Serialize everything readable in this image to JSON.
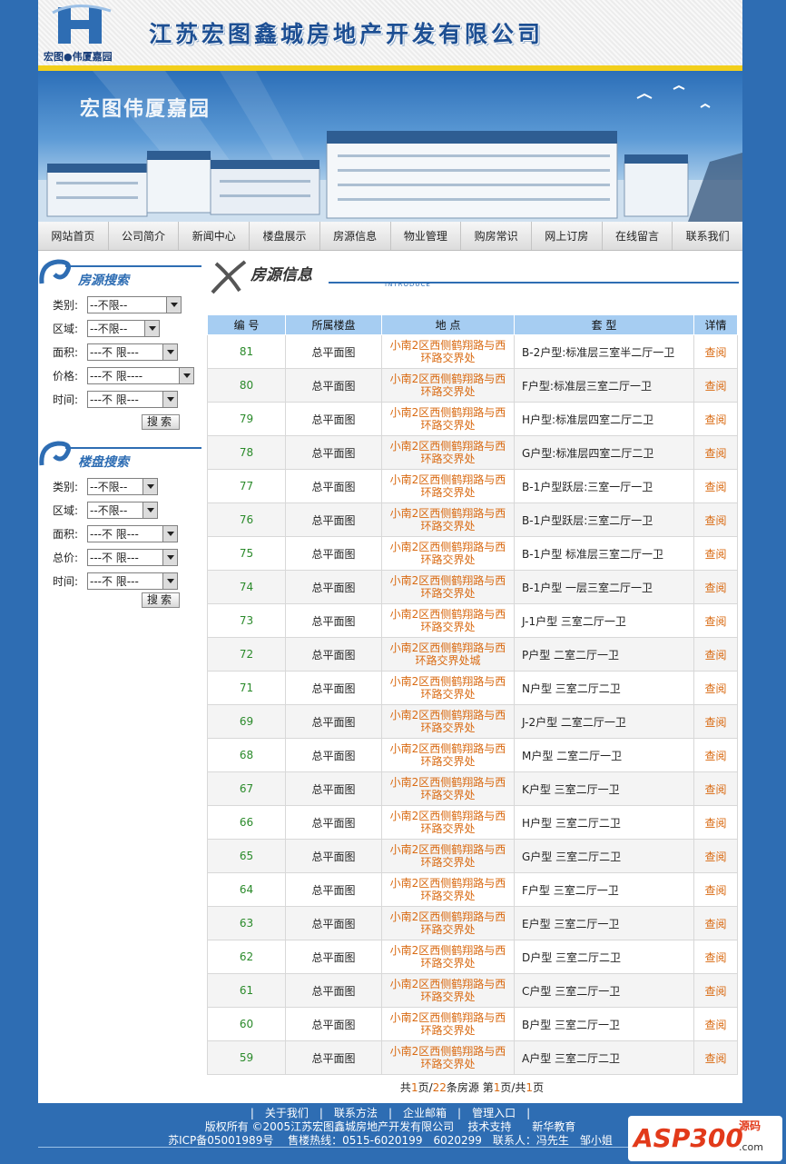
{
  "header": {
    "logo_caption": "宏图●伟厦嘉园",
    "company_name": "江苏宏图鑫城房地产开发有限公司"
  },
  "banner": {
    "title": "宏图伟厦嘉园"
  },
  "nav": [
    "网站首页",
    "公司简介",
    "新闻中心",
    "楼盘展示",
    "房源信息",
    "物业管理",
    "购房常识",
    "网上订房",
    "在线留言",
    "联系我们"
  ],
  "sidebar": {
    "house_search": {
      "title": "房源搜索",
      "fields": [
        {
          "label": "类别:",
          "value": "--不限--"
        },
        {
          "label": "区域:",
          "value": "--不限--"
        },
        {
          "label": "面积:",
          "value": "---不 限---"
        },
        {
          "label": "价格:",
          "value": "---不 限----"
        },
        {
          "label": "时间:",
          "value": "---不 限---"
        }
      ],
      "button": "搜索"
    },
    "estate_search": {
      "title": "楼盘搜索",
      "fields": [
        {
          "label": "类别:",
          "value": "--不限--"
        },
        {
          "label": "区域:",
          "value": "--不限--"
        },
        {
          "label": "面积:",
          "value": "---不 限---"
        },
        {
          "label": "总价:",
          "value": "---不 限---"
        },
        {
          "label": "时间:",
          "value": "---不 限---"
        }
      ],
      "button": "搜索"
    }
  },
  "content": {
    "title": "房源信息",
    "subtitle": "INTRODUCE",
    "columns": [
      "编 号",
      "所属楼盘",
      "地  点",
      "套  型",
      "详情"
    ],
    "rows": [
      {
        "id": "81",
        "estate": "总平面图",
        "location": "小南2区西侧鹤翔路与西环路交界处",
        "type": "B-2户型:标准层三室半二厅一卫",
        "detail": "查阅"
      },
      {
        "id": "80",
        "estate": "总平面图",
        "location": "小南2区西侧鹤翔路与西环路交界处",
        "type": "F户型:标准层三室二厅一卫",
        "detail": "查阅"
      },
      {
        "id": "79",
        "estate": "总平面图",
        "location": "小南2区西侧鹤翔路与西环路交界处",
        "type": "H户型:标准层四室二厅二卫",
        "detail": "查阅"
      },
      {
        "id": "78",
        "estate": "总平面图",
        "location": "小南2区西侧鹤翔路与西环路交界处",
        "type": "G户型:标准层四室二厅二卫",
        "detail": "查阅"
      },
      {
        "id": "77",
        "estate": "总平面图",
        "location": "小南2区西侧鹤翔路与西环路交界处",
        "type": "B-1户型跃层:三室一厅一卫",
        "detail": "查阅"
      },
      {
        "id": "76",
        "estate": "总平面图",
        "location": "小南2区西侧鹤翔路与西环路交界处",
        "type": "B-1户型跃层:三室二厅一卫",
        "detail": "查阅"
      },
      {
        "id": "75",
        "estate": "总平面图",
        "location": "小南2区西侧鹤翔路与西环路交界处",
        "type": "B-1户型 标准层三室二厅一卫",
        "detail": "查阅"
      },
      {
        "id": "74",
        "estate": "总平面图",
        "location": "小南2区西侧鹤翔路与西环路交界处",
        "type": "B-1户型 一层三室二厅一卫",
        "detail": "查阅"
      },
      {
        "id": "73",
        "estate": "总平面图",
        "location": "小南2区西侧鹤翔路与西环路交界处",
        "type": "J-1户型 三室二厅一卫",
        "detail": "查阅"
      },
      {
        "id": "72",
        "estate": "总平面图",
        "location": "小南2区西侧鹤翔路与西环路交界处城",
        "type": "P户型 二室二厅一卫",
        "detail": "查阅"
      },
      {
        "id": "71",
        "estate": "总平面图",
        "location": "小南2区西侧鹤翔路与西环路交界处",
        "type": "N户型 三室二厅二卫",
        "detail": "查阅"
      },
      {
        "id": "69",
        "estate": "总平面图",
        "location": "小南2区西侧鹤翔路与西环路交界处",
        "type": "J-2户型 二室二厅一卫",
        "detail": "查阅"
      },
      {
        "id": "68",
        "estate": "总平面图",
        "location": "小南2区西侧鹤翔路与西环路交界处",
        "type": "M户型 二室二厅一卫",
        "detail": "查阅"
      },
      {
        "id": "67",
        "estate": "总平面图",
        "location": "小南2区西侧鹤翔路与西环路交界处",
        "type": "K户型 三室二厅一卫",
        "detail": "查阅"
      },
      {
        "id": "66",
        "estate": "总平面图",
        "location": "小南2区西侧鹤翔路与西环路交界处",
        "type": "H户型 三室二厅二卫",
        "detail": "查阅"
      },
      {
        "id": "65",
        "estate": "总平面图",
        "location": "小南2区西侧鹤翔路与西环路交界处",
        "type": "G户型 三室二厅二卫",
        "detail": "查阅"
      },
      {
        "id": "64",
        "estate": "总平面图",
        "location": "小南2区西侧鹤翔路与西环路交界处",
        "type": "F户型 三室二厅一卫",
        "detail": "查阅"
      },
      {
        "id": "63",
        "estate": "总平面图",
        "location": "小南2区西侧鹤翔路与西环路交界处",
        "type": "E户型 三室二厅一卫",
        "detail": "查阅"
      },
      {
        "id": "62",
        "estate": "总平面图",
        "location": "小南2区西侧鹤翔路与西环路交界处",
        "type": "D户型 三室二厅二卫",
        "detail": "查阅"
      },
      {
        "id": "61",
        "estate": "总平面图",
        "location": "小南2区西侧鹤翔路与西环路交界处",
        "type": "C户型 三室二厅一卫",
        "detail": "查阅"
      },
      {
        "id": "60",
        "estate": "总平面图",
        "location": "小南2区西侧鹤翔路与西环路交界处",
        "type": "B户型 三室二厅一卫",
        "detail": "查阅"
      },
      {
        "id": "59",
        "estate": "总平面图",
        "location": "小南2区西侧鹤翔路与西环路交界处",
        "type": "A户型 三室二厅二卫",
        "detail": "查阅"
      }
    ],
    "pager": {
      "p1": "共",
      "total_pages": "1",
      "p2": "页/",
      "total_items": "22",
      "p3": "条房源 第",
      "current": "1",
      "p4": "页/共",
      "pages": "1",
      "p5": "页"
    }
  },
  "footer": {
    "links": [
      "关于我们",
      "联系方法",
      "企业邮箱",
      "管理入口"
    ],
    "copyright": "版权所有 ©2005江苏宏图鑫城房地产开发有限公司",
    "tech_support": "技术支持",
    "tech_support_name": "新华教育",
    "line3": "苏ICP备05001989号　 售楼热线：0515-6020199　6020299　联系人：冯先生　邹小姐"
  },
  "watermark": {
    "brand": "ASP300",
    "yuan": "源码",
    "domain": ".com"
  },
  "colors": {
    "page_bg": "#2e6db3",
    "accent_orange": "#d96a12",
    "id_green": "#2a8a2a",
    "table_head": "#a6cdf2",
    "header_stripe": "#f2cf1c"
  }
}
